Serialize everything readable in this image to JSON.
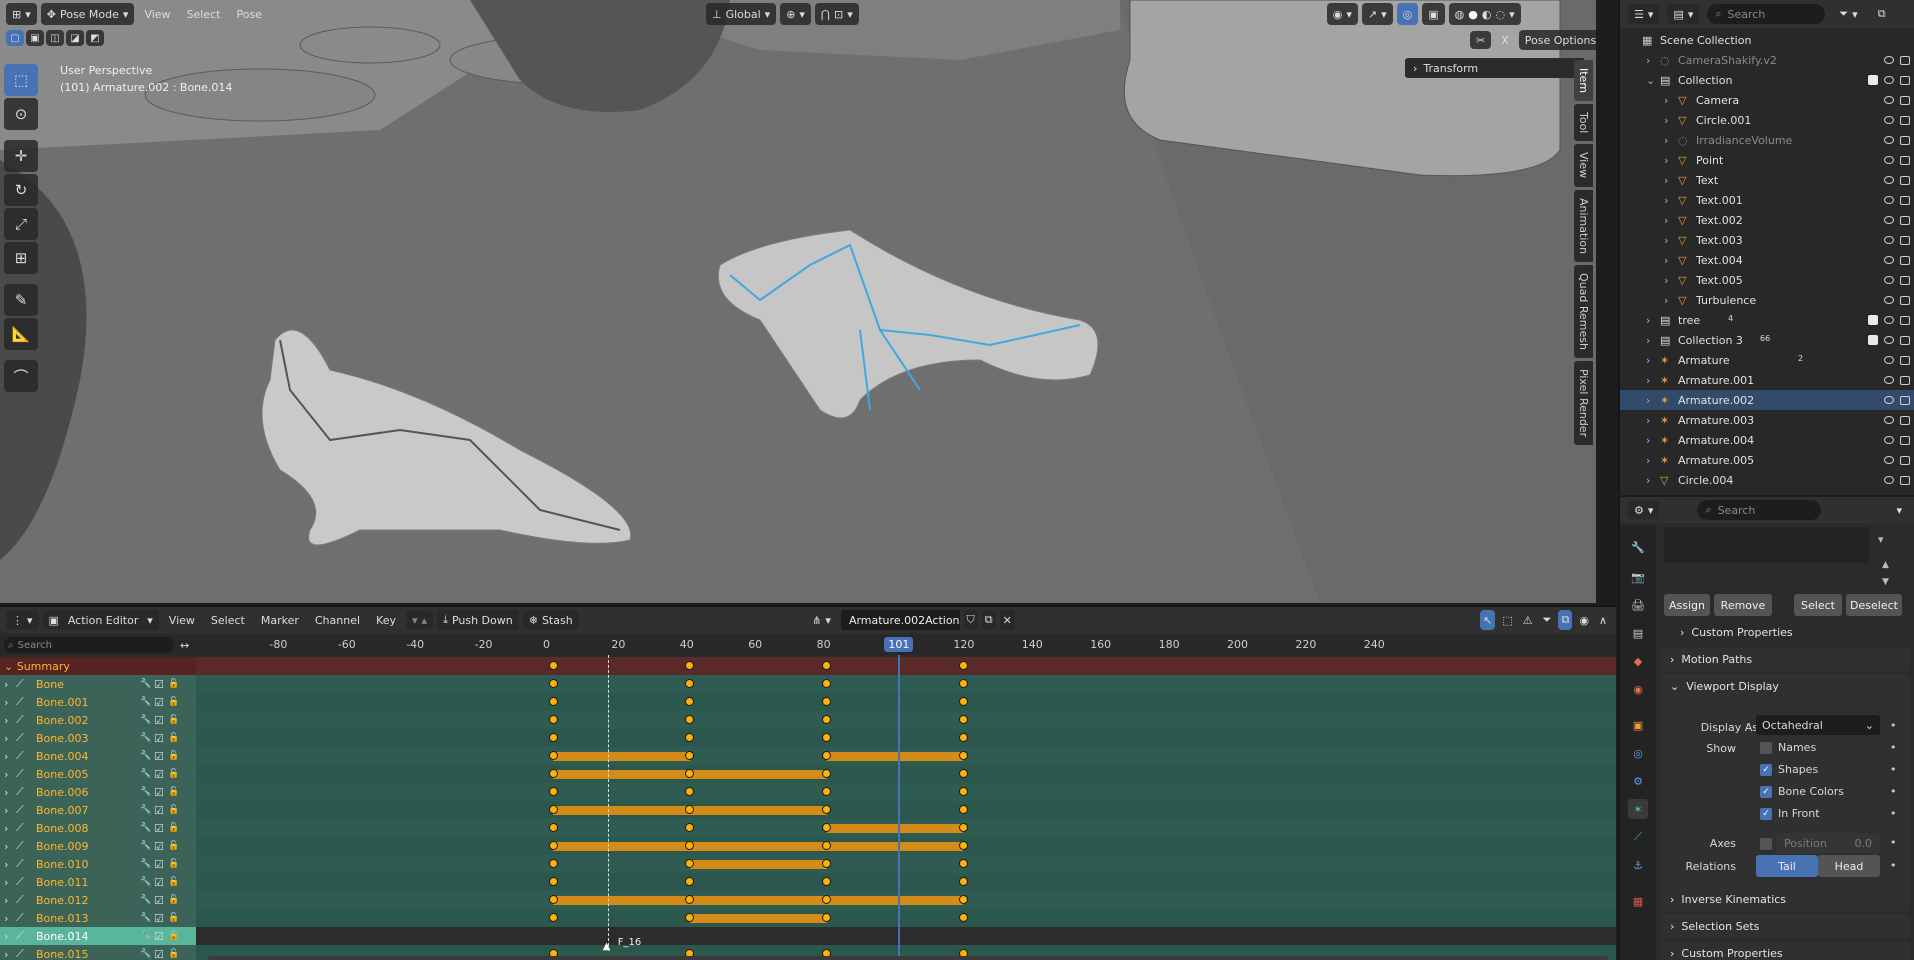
{
  "viewport": {
    "mode": "Pose Mode",
    "menus": [
      "View",
      "Select",
      "Pose"
    ],
    "orientation": "Global",
    "perspective": "User Perspective",
    "object_label": "(101) Armature.002 : Bone.014",
    "transform_panel": "Transform",
    "pose_options": "Pose Options",
    "x_label": "X",
    "side_tabs": [
      "Item",
      "Tool",
      "View",
      "Animation",
      "Quad Remesh",
      "Pixel Render"
    ]
  },
  "outliner": {
    "search_placeholder": "Search",
    "items": [
      {
        "label": "Scene Collection",
        "kind": "scene"
      },
      {
        "label": "CameraShakify.v2",
        "kind": "dim"
      },
      {
        "label": "Collection",
        "kind": "coll"
      },
      {
        "label": "Camera",
        "kind": "obj"
      },
      {
        "label": "Circle.001",
        "kind": "obj"
      },
      {
        "label": "IrradianceVolume",
        "kind": "dim"
      },
      {
        "label": "Point",
        "kind": "obj"
      },
      {
        "label": "Text",
        "kind": "obj"
      },
      {
        "label": "Text.001",
        "kind": "obj"
      },
      {
        "label": "Text.002",
        "kind": "obj"
      },
      {
        "label": "Text.003",
        "kind": "obj"
      },
      {
        "label": "Text.004",
        "kind": "obj"
      },
      {
        "label": "Text.005",
        "kind": "obj"
      },
      {
        "label": "Turbulence",
        "kind": "obj"
      },
      {
        "label": "tree",
        "kind": "coll"
      },
      {
        "label": "Collection 3",
        "kind": "coll"
      },
      {
        "label": "Armature",
        "kind": "arm"
      },
      {
        "label": "Armature.001",
        "kind": "arm"
      },
      {
        "label": "Armature.002",
        "kind": "arm"
      },
      {
        "label": "Armature.003",
        "kind": "arm"
      },
      {
        "label": "Armature.004",
        "kind": "arm"
      },
      {
        "label": "Armature.005",
        "kind": "arm"
      },
      {
        "label": "Circle.004",
        "kind": "obj"
      }
    ],
    "badges": {
      "tree": "4",
      "collection3": "66",
      "armature": "2"
    }
  },
  "properties": {
    "search_placeholder": "Search",
    "buttons": {
      "assign": "Assign",
      "remove": "Remove",
      "select": "Select",
      "deselect": "Deselect"
    },
    "panels": {
      "custom_properties_1": "Custom Properties",
      "motion_paths": "Motion Paths",
      "viewport_display": "Viewport Display",
      "inverse_kinematics": "Inverse Kinematics",
      "selection_sets": "Selection Sets",
      "custom_properties_2": "Custom Properties"
    },
    "display_as_label": "Display As",
    "display_as_value": "Octahedral",
    "show_label": "Show",
    "show_options": [
      {
        "label": "Names",
        "checked": false
      },
      {
        "label": "Shapes",
        "checked": true
      },
      {
        "label": "Bone Colors",
        "checked": true
      },
      {
        "label": "In Front",
        "checked": true
      }
    ],
    "axes_label": "Axes",
    "position_label": "Position",
    "position_value": "0.0",
    "relations_label": "Relations",
    "relations_tail": "Tail",
    "relations_head": "Head"
  },
  "action_editor": {
    "mode": "Action Editor",
    "menus": [
      "View",
      "Select",
      "Marker",
      "Channel",
      "Key"
    ],
    "push_down": "Push Down",
    "stash": "Stash",
    "action_name": "Armature.002Action",
    "search_placeholder": "Search",
    "current_frame": "101",
    "marker_label": "F_16",
    "marker_frame": 16,
    "frame_ticks": [
      "-80",
      "-60",
      "-40",
      "-20",
      "0",
      "20",
      "40",
      "60",
      "80",
      "120",
      "140",
      "160",
      "180",
      "200",
      "220",
      "240"
    ],
    "summary_label": "Summary",
    "keyframes": [
      0,
      40,
      80,
      120
    ],
    "channels": [
      {
        "name": "Bone",
        "holds": []
      },
      {
        "name": "Bone.001",
        "holds": []
      },
      {
        "name": "Bone.002",
        "holds": []
      },
      {
        "name": "Bone.003",
        "holds": []
      },
      {
        "name": "Bone.004",
        "holds": [
          [
            0,
            40
          ],
          [
            80,
            120
          ]
        ]
      },
      {
        "name": "Bone.005",
        "holds": [
          [
            0,
            40
          ],
          [
            40,
            80
          ]
        ]
      },
      {
        "name": "Bone.006",
        "holds": []
      },
      {
        "name": "Bone.007",
        "holds": [
          [
            0,
            40
          ],
          [
            40,
            80
          ]
        ]
      },
      {
        "name": "Bone.008",
        "holds": [
          [
            80,
            120
          ]
        ]
      },
      {
        "name": "Bone.009",
        "holds": [
          [
            0,
            40
          ],
          [
            40,
            80
          ],
          [
            80,
            120
          ]
        ]
      },
      {
        "name": "Bone.010",
        "holds": [
          [
            40,
            80
          ]
        ]
      },
      {
        "name": "Bone.011",
        "holds": []
      },
      {
        "name": "Bone.012",
        "holds": [
          [
            0,
            40
          ],
          [
            40,
            80
          ],
          [
            80,
            120
          ]
        ]
      },
      {
        "name": "Bone.013",
        "holds": [
          [
            40,
            80
          ]
        ]
      },
      {
        "name": "Bone.014",
        "holds": [],
        "selected": true
      },
      {
        "name": "Bone.015",
        "holds": []
      }
    ]
  }
}
